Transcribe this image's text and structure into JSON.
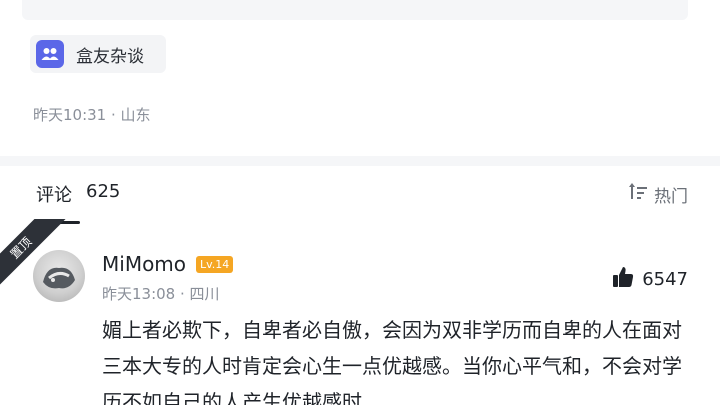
{
  "tag": {
    "label": "盒友杂谈",
    "icon": "group-icon",
    "icon_color": "#5b67e8"
  },
  "post": {
    "meta": "昨天10:31 · 山东"
  },
  "comments": {
    "title": "评论",
    "count": "625",
    "sort_label": "热门",
    "sort_icon": "sort-icon"
  },
  "pinned_comment": {
    "badge": "置顶",
    "username": "MiMomo",
    "level": "Lv.14",
    "meta": "昨天13:08 · 四川",
    "likes": "6547",
    "text": "媚上者必欺下，自卑者必自傲，会因为双非学历而自卑的人在面对三本大专的人时肯定会心生一点优越感。当你心平气和，不会对学历不如自己的人产生优越感时"
  },
  "colors": {
    "level_badge": "#f5a623",
    "pinned_badge": "#2d3138",
    "meta_text": "#8a8f99"
  }
}
